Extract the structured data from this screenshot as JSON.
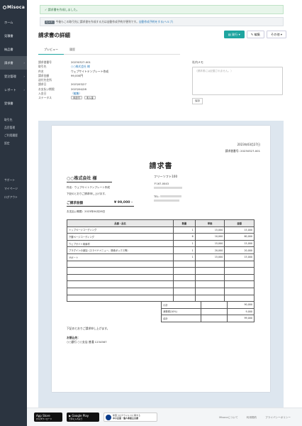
{
  "app": {
    "logo": "Misoca"
  },
  "sidebar": {
    "items": [
      {
        "label": "ホーム"
      },
      {
        "label": "見積書"
      },
      {
        "label": "納品書"
      },
      {
        "label": "請求書",
        "active": true
      },
      {
        "label": "受注管理"
      },
      {
        "label": "レポート"
      },
      {
        "label": "受領書"
      }
    ],
    "sub": [
      {
        "label": "取引先"
      },
      {
        "label": "品目管理"
      },
      {
        "label": "ご利用履歴"
      },
      {
        "label": "設定"
      }
    ],
    "bottom": [
      {
        "label": "サポート"
      },
      {
        "label": "マイページ"
      },
      {
        "label": "ログアウト"
      }
    ]
  },
  "alerts": {
    "success": "✓ 請求書を作成しました。",
    "info_badge": "ヒント",
    "info_text": "今後もこの取引先に請求書を作成する方は自動作成予約が便利です。",
    "info_link": "自動作成予約をする(ヘルプ)"
  },
  "page": {
    "title": "請求書の詳細",
    "issue_button": "発行",
    "edit_button": "編集",
    "other_button": "その他"
  },
  "tabs": [
    {
      "label": "プレビュー"
    },
    {
      "label": "履歴"
    }
  ],
  "details": [
    {
      "key": "請求書番号",
      "value": "20230327-001"
    },
    {
      "key": "取引先",
      "value": "○○株式会社 様"
    },
    {
      "key": "件名",
      "value": "ウェブサイトテンプレート作成"
    },
    {
      "key": "請求金額",
      "value": "99,000円"
    },
    {
      "key": "送付先住所",
      "value": ""
    },
    {
      "key": "請求日",
      "value": "2023/03/27"
    },
    {
      "key": "お支払い期限",
      "value": "2023/04/28"
    },
    {
      "key": "入金日",
      "value": "（編集）"
    },
    {
      "key": "ステータス",
      "value": ""
    }
  ],
  "status_pills": [
    "未送付",
    "未入金"
  ],
  "memo": {
    "label": "社内メモ",
    "placeholder": "（請求書には記載されません。）",
    "save": "保存"
  },
  "invoice": {
    "date": "2023年03月27日",
    "number": "請求書番号: 20230327-001",
    "doc_title": "請求書",
    "customer": "○○株式会社 様",
    "subject": "件名：ウェブサイトテンプレート作成",
    "greeting": "下記のとおりご請求申し上げます。",
    "total_label": "ご請求金額",
    "total_value": "¥ 99,000 -",
    "due": "お支払い期限：2023年04月28日",
    "issuer": "フリーソフト100",
    "postal": "〒167-0043",
    "tel": "TEL:",
    "headers": [
      "品番・品名",
      "数量",
      "単価",
      "金額"
    ],
    "rows": [
      [
        "トップページコーディング",
        "1",
        "15,000",
        "15,000"
      ],
      [
        "下層ページコーディング",
        "6",
        "10,000",
        "60,000"
      ],
      [
        "ウェブサイト用素材",
        "1",
        "15,000",
        "15,000"
      ],
      [
        "プラグインの追加（スライドメニュー、検索ボックス等）",
        "1",
        "20,000",
        "20,000"
      ],
      [
        "サポート",
        "1",
        "15,000",
        "15,000"
      ],
      [
        "",
        "",
        "",
        ""
      ],
      [
        "",
        "",
        "",
        ""
      ],
      [
        "",
        "",
        "",
        ""
      ],
      [
        "",
        "",
        "",
        ""
      ],
      [
        "",
        "",
        "",
        ""
      ],
      [
        "",
        "",
        "",
        ""
      ]
    ],
    "totals": [
      {
        "label": "小計",
        "value": "90,000"
      },
      {
        "label": "消費税(10%)",
        "value": "9,000"
      },
      {
        "label": "合計",
        "value": "99,000"
      }
    ],
    "closing": "下記のとおりご請求申し上げます。",
    "bank_label": "お振込先：",
    "bank": "○○銀行 ○○支店 普通 1234567"
  },
  "footer": {
    "appstore_top": "App Store",
    "appstore_sub": "からダウンロード",
    "gplay_top": "Google Play",
    "gplay_sub": "で手に入れよう",
    "loan_line1": "新型コロナウイルスに関する",
    "loan_line2": "中小企業・個人事業主支援",
    "links": [
      "Misocaについて",
      "利用規約",
      "プライバシーポリシー"
    ]
  }
}
